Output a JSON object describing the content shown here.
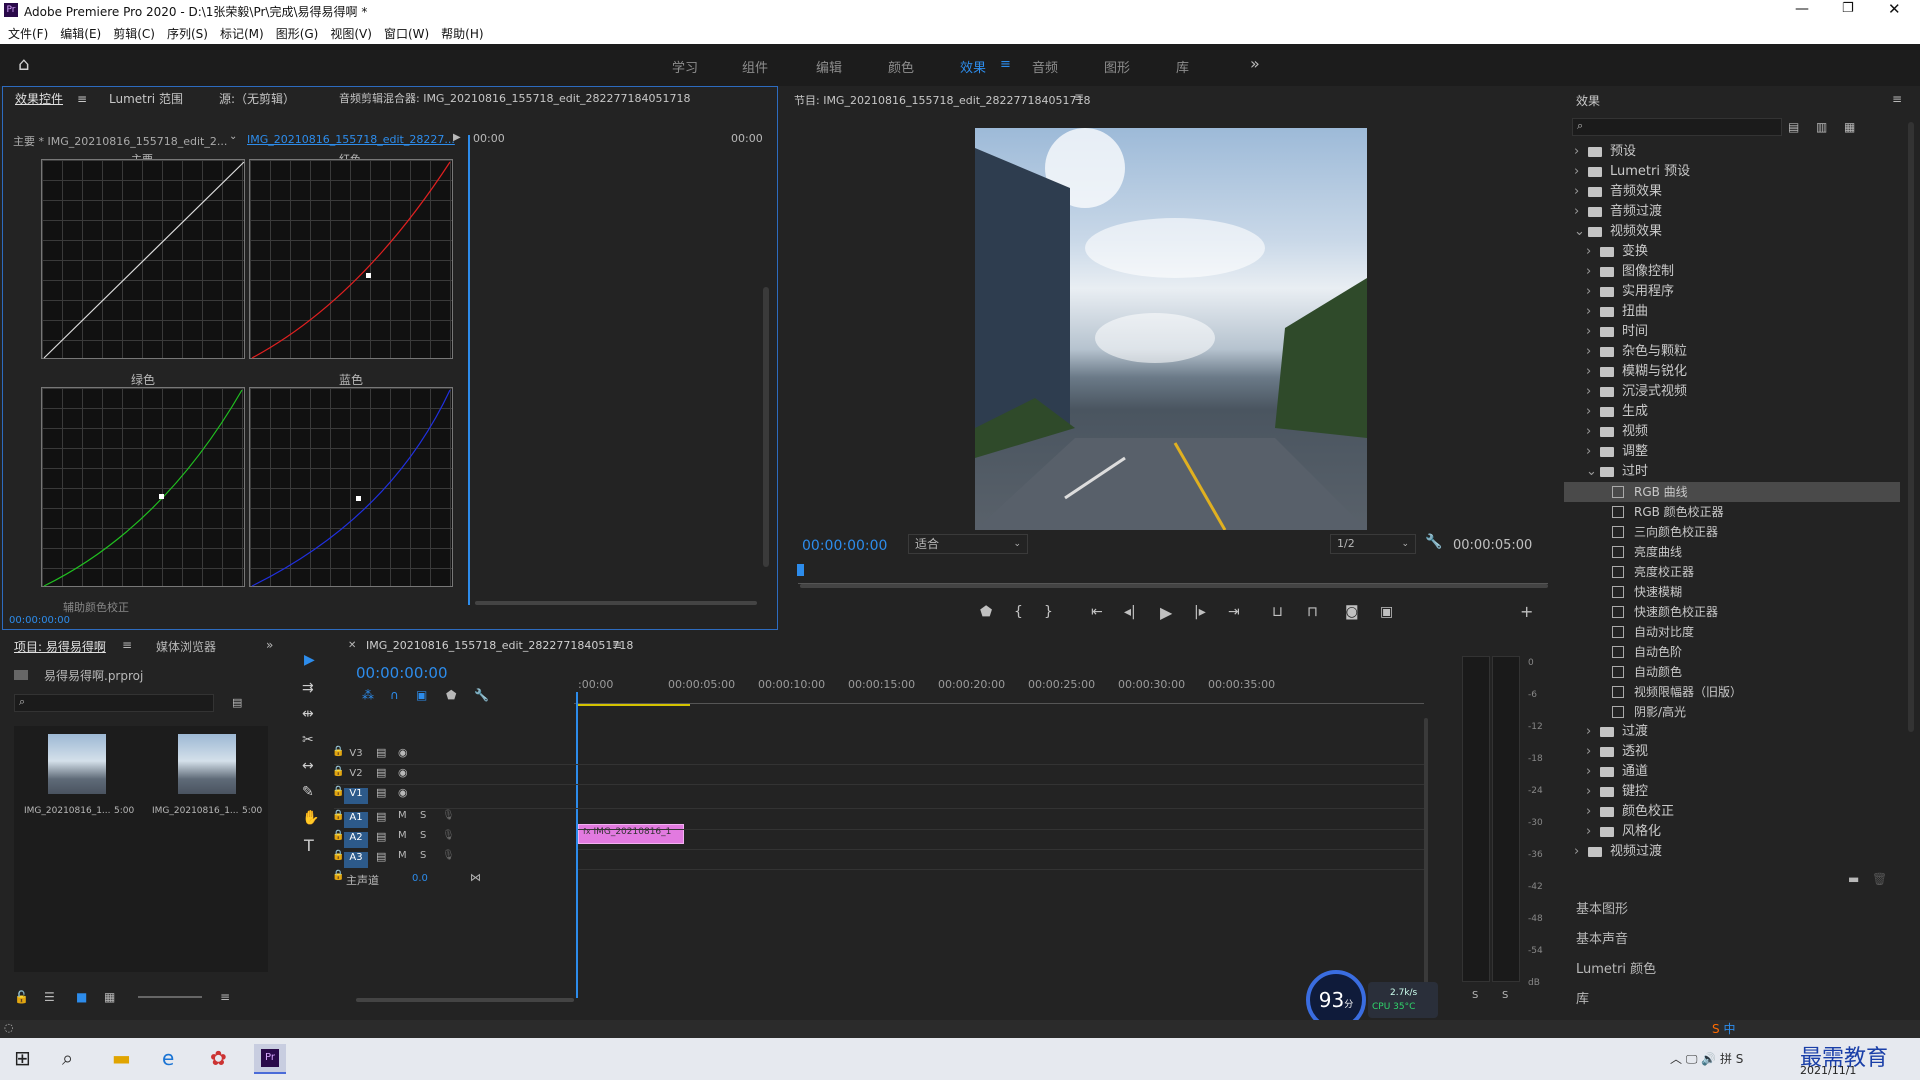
{
  "window": {
    "title": "Adobe Premiere Pro 2020 - D:\\1张荣毅\\Pr\\完成\\易得易得啊 *",
    "app_icon": "Pr"
  },
  "menu": [
    "文件(F)",
    "编辑(E)",
    "剪辑(C)",
    "序列(S)",
    "标记(M)",
    "图形(G)",
    "视图(V)",
    "窗口(W)",
    "帮助(H)"
  ],
  "workspaces": [
    "学习",
    "组件",
    "编辑",
    "颜色",
    "效果",
    "音频",
    "图形",
    "库"
  ],
  "workspace_active": "效果",
  "effect_controls": {
    "tabs": [
      "效果控件",
      "Lumetri 范围",
      "源:（无剪辑）",
      "音频剪辑混合器: IMG_20210816_155718_edit_282277184051718"
    ],
    "master": "主要 * IMG_20210816_155718_edit_2...",
    "clip": "IMG_20210816_155718_edit_28227...",
    "time_start": "00:00",
    "time_end": "00:00",
    "curves": [
      "主要",
      "红色",
      "绿色",
      "蓝色"
    ],
    "aux": "辅助颜色校正",
    "timecode": "00:00:00:00"
  },
  "program": {
    "title": "节目: IMG_20210816_155718_edit_282277184051718",
    "timecode": "00:00:00:00",
    "fit": "适合",
    "res": "1/2",
    "duration": "00:00:05:00"
  },
  "effects_panel": {
    "title": "效果",
    "items": [
      {
        "label": "预设",
        "level": 0,
        "type": "folder"
      },
      {
        "label": "Lumetri 预设",
        "level": 0,
        "type": "folder"
      },
      {
        "label": "音频效果",
        "level": 0,
        "type": "folder"
      },
      {
        "label": "音频过渡",
        "level": 0,
        "type": "folder"
      },
      {
        "label": "视频效果",
        "level": 0,
        "type": "folder",
        "open": true
      },
      {
        "label": "变换",
        "level": 1,
        "type": "folder"
      },
      {
        "label": "图像控制",
        "level": 1,
        "type": "folder"
      },
      {
        "label": "实用程序",
        "level": 1,
        "type": "folder"
      },
      {
        "label": "扭曲",
        "level": 1,
        "type": "folder"
      },
      {
        "label": "时间",
        "level": 1,
        "type": "folder"
      },
      {
        "label": "杂色与颗粒",
        "level": 1,
        "type": "folder"
      },
      {
        "label": "模糊与锐化",
        "level": 1,
        "type": "folder"
      },
      {
        "label": "沉浸式视频",
        "level": 1,
        "type": "folder"
      },
      {
        "label": "生成",
        "level": 1,
        "type": "folder"
      },
      {
        "label": "视频",
        "level": 1,
        "type": "folder"
      },
      {
        "label": "调整",
        "level": 1,
        "type": "folder"
      },
      {
        "label": "过时",
        "level": 1,
        "type": "folder",
        "open": true
      },
      {
        "label": "RGB 曲线",
        "level": 2,
        "type": "fx",
        "selected": true
      },
      {
        "label": "RGB 颜色校正器",
        "level": 2,
        "type": "fx"
      },
      {
        "label": "三向颜色校正器",
        "level": 2,
        "type": "fx"
      },
      {
        "label": "亮度曲线",
        "level": 2,
        "type": "fx"
      },
      {
        "label": "亮度校正器",
        "level": 2,
        "type": "fx"
      },
      {
        "label": "快速模糊",
        "level": 2,
        "type": "fx"
      },
      {
        "label": "快速颜色校正器",
        "level": 2,
        "type": "fx"
      },
      {
        "label": "自动对比度",
        "level": 2,
        "type": "fx"
      },
      {
        "label": "自动色阶",
        "level": 2,
        "type": "fx"
      },
      {
        "label": "自动颜色",
        "level": 2,
        "type": "fx"
      },
      {
        "label": "视频限幅器（旧版）",
        "level": 2,
        "type": "fx"
      },
      {
        "label": "阴影/高光",
        "level": 2,
        "type": "fx"
      },
      {
        "label": "过渡",
        "level": 1,
        "type": "folder"
      },
      {
        "label": "透视",
        "level": 1,
        "type": "folder"
      },
      {
        "label": "通道",
        "level": 1,
        "type": "folder"
      },
      {
        "label": "键控",
        "level": 1,
        "type": "folder"
      },
      {
        "label": "颜色校正",
        "level": 1,
        "type": "folder"
      },
      {
        "label": "风格化",
        "level": 1,
        "type": "folder"
      },
      {
        "label": "视频过渡",
        "level": 0,
        "type": "folder"
      }
    ],
    "sections": [
      "基本图形",
      "基本声音",
      "Lumetri 颜色",
      "库"
    ]
  },
  "project": {
    "tabs": [
      "项目: 易得易得啊",
      "媒体浏览器"
    ],
    "file": "易得易得啊.prproj",
    "clips": [
      {
        "name": "IMG_20210816_1...",
        "dur": "5:00"
      },
      {
        "name": "IMG_20210816_1...",
        "dur": "5:00"
      }
    ]
  },
  "timeline": {
    "tab": "IMG_20210816_155718_edit_282277184051718",
    "timecode": "00:00:00:00",
    "ruler": [
      ":00:00",
      "00:00:05:00",
      "00:00:10:00",
      "00:00:15:00",
      "00:00:20:00",
      "00:00:25:00",
      "00:00:30:00",
      "00:00:35:00"
    ],
    "video_tracks": [
      "V3",
      "V2",
      "V1"
    ],
    "audio_tracks": [
      "A1",
      "A2",
      "A3"
    ],
    "master": "主声道",
    "master_val": "0.0",
    "clip": "IMG_20210816_1"
  },
  "meter": {
    "scale": [
      "0",
      "-6",
      "-12",
      "-18",
      "-24",
      "-30",
      "-36",
      "-42",
      "-48",
      "-54",
      "dB"
    ],
    "solo": [
      "S",
      "S"
    ]
  },
  "widget": {
    "score": "93",
    "unit": "分",
    "net": "2.7k/s",
    "cpu": "CPU 35°C"
  },
  "taskbar": {
    "date": "2021/11/1",
    "watermark": "最需教育",
    "ime": "中"
  }
}
